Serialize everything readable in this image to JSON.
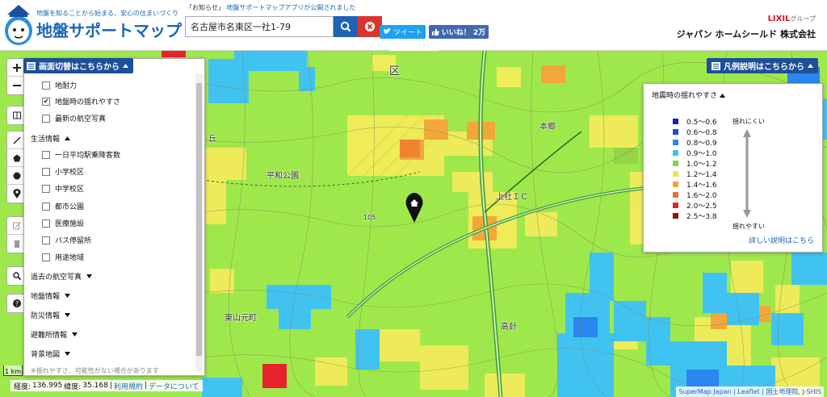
{
  "header": {
    "tagline": "地盤を知ることから始まる、安心の住まいづくり",
    "title": "地盤サポートマップ",
    "news_prefix": "「お知らせ」",
    "news_link": "地盤サポートマップアプリが公開されました",
    "search_value": "名古屋市名東区一社1-79",
    "tweet_label": "ツイート",
    "like_label": "いいね！ 2万",
    "lixil": "LIXIL",
    "lixil_group": "グループ",
    "company": "ジャパン ホームシールド 株式会社"
  },
  "layer_panel": {
    "toggle_label": "画面切替はこちらから",
    "items": [
      {
        "label": "地耐力",
        "checked": ""
      },
      {
        "label": "地盤時の揺れやすさ",
        "checked": "✔"
      },
      {
        "label": "最新の航空写真",
        "checked": ""
      }
    ],
    "life_header": "生活情報",
    "life_items": [
      {
        "label": "一日平均駅乗降客数"
      },
      {
        "label": "小学校区"
      },
      {
        "label": "中学校区"
      },
      {
        "label": "都市公園"
      },
      {
        "label": "医療施設"
      },
      {
        "label": "バス停留所"
      },
      {
        "label": "用途地域"
      }
    ],
    "sections": [
      {
        "label": "過去の航空写真"
      },
      {
        "label": "地盤情報"
      },
      {
        "label": "防災情報"
      },
      {
        "label": "避難所情報"
      },
      {
        "label": "背景地図"
      }
    ],
    "cut_text": "※揺れやすさ、可能性がない場合があります"
  },
  "legend": {
    "toggle_label": "凡例説明はこちらから",
    "title": "地震時の揺れやすさ",
    "rows": [
      {
        "range": "0.5～0.6",
        "color": "#1a1ad6"
      },
      {
        "range": "0.6～0.8",
        "color": "#1f4de0"
      },
      {
        "range": "0.8～0.9",
        "color": "#2a86f0"
      },
      {
        "range": "0.9～1.0",
        "color": "#41c3f2"
      },
      {
        "range": "1.0～1.2",
        "color": "#6ee04a"
      },
      {
        "range": "1.2～1.4",
        "color": "#e8e84a"
      },
      {
        "range": "1.4～1.6",
        "color": "#f3a63a"
      },
      {
        "range": "1.6～2.0",
        "color": "#f06a2a"
      },
      {
        "range": "2.0～2.5",
        "color": "#e4242a"
      },
      {
        "range": "2.5～3.8",
        "color": "#8a1414"
      }
    ],
    "top_text": "揺れにくい",
    "bottom_text": "揺れやすい",
    "detail_link": "詳しい説明はこちら"
  },
  "map": {
    "labels": [
      {
        "text": "区",
        "name": "ward-label"
      },
      {
        "text": "丘",
        "name": "oka-label"
      },
      {
        "text": "平和公園",
        "name": "heiwa-park-label"
      },
      {
        "text": "本郷",
        "name": "hongo-label"
      },
      {
        "text": "上社ＩＣ",
        "name": "kamiyashiro-ic-label"
      },
      {
        "text": "105",
        "name": "route-105-label"
      },
      {
        "text": "東山元町",
        "name": "higashiyama-label"
      },
      {
        "text": "高針",
        "name": "takabari-label"
      }
    ],
    "scale": "1 km"
  },
  "coords": {
    "lon_label": "経度:",
    "lon": "136.995",
    "lat_label": "緯度:",
    "lat": "35.168",
    "sep": "|",
    "terms": "利用規約",
    "data": "データについて"
  },
  "attribution": "SuperMap Japan | Leaflet | 国土地理院, J-SHIS",
  "icons": {
    "search": "search-icon",
    "clear": "clear-icon",
    "pin": "home-pin-icon"
  },
  "colors": {
    "brand_blue": "#1a66b8",
    "panel_header": "#1e4f9a",
    "base_green": "#9fe84c"
  }
}
